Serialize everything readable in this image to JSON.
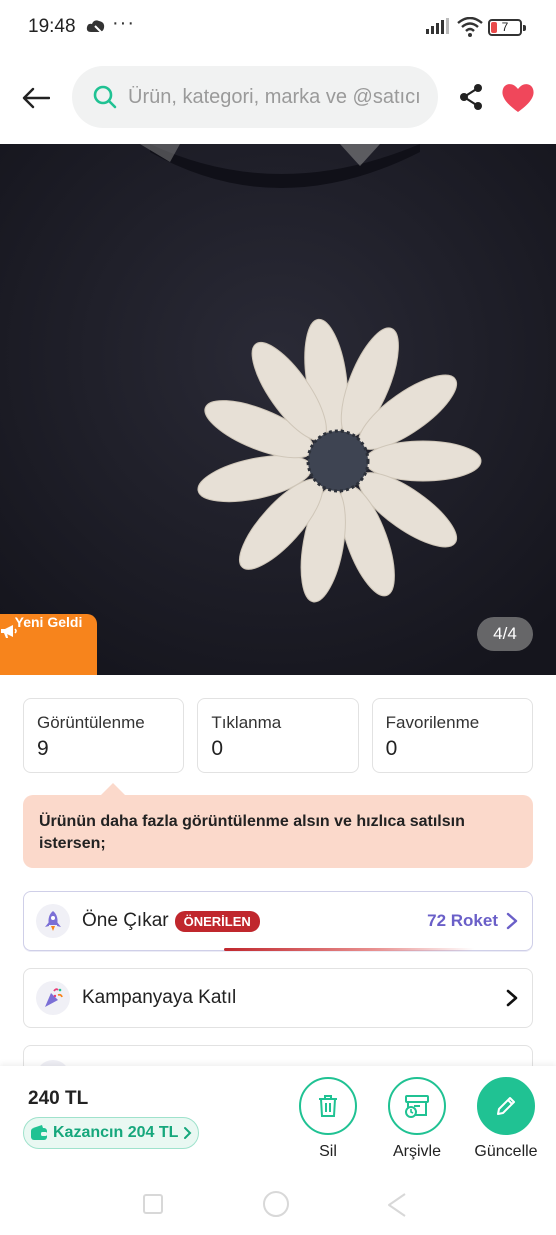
{
  "status_bar": {
    "time": "19:48",
    "dots": "···",
    "battery": "7"
  },
  "header": {
    "search_placeholder": "Ürün, kategori, marka ve @satıcı",
    "favorite_color": "#f0475b"
  },
  "image": {
    "badge": "Yeni Geldi",
    "counter": "4/4"
  },
  "stats": [
    {
      "label": "Görüntülenme",
      "value": "9"
    },
    {
      "label": "Tıklanma",
      "value": "0"
    },
    {
      "label": "Favorilenme",
      "value": "0"
    }
  ],
  "tip": "Ürünün daha fazla görüntülenme alsın ve hızlıca satılsın istersen;",
  "actions": [
    {
      "label": "Öne Çıkar",
      "badge": "ÖNERİLEN",
      "price": "72 Roket",
      "icon": "rocket-icon"
    },
    {
      "label": "Kampanyaya Katıl",
      "icon": "party-icon"
    }
  ],
  "bottom": {
    "price": "240 TL",
    "earning": "Kazancın 204 TL",
    "buttons": [
      "Sil",
      "Arşivle",
      "Güncelle"
    ],
    "accent_color": "#20c293"
  }
}
